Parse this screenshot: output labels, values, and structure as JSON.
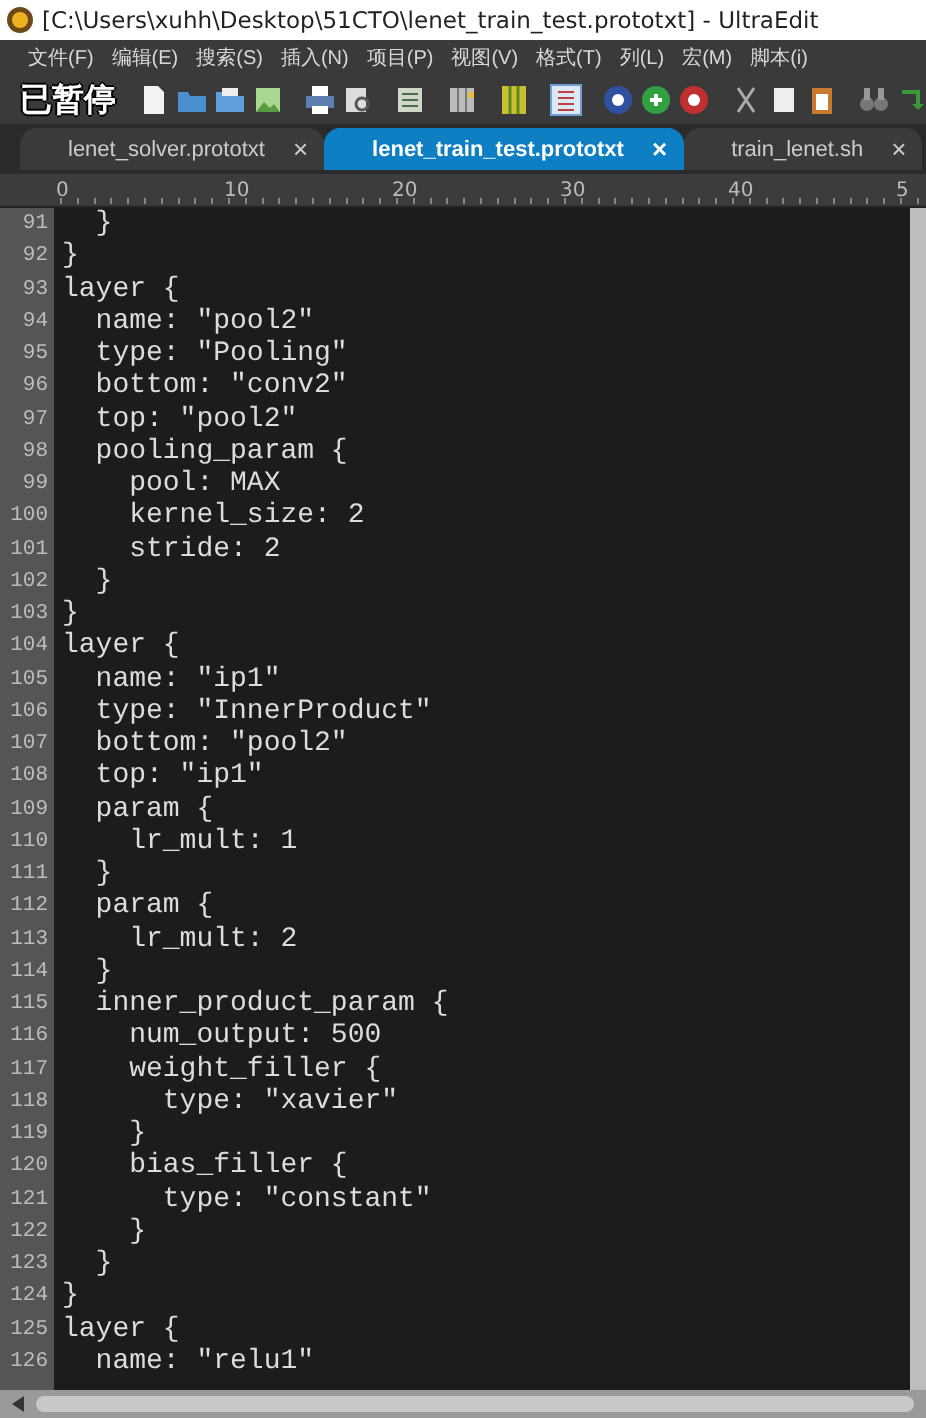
{
  "window": {
    "title": "[C:\\Users\\xuhh\\Desktop\\51CTO\\lenet_train_test.prototxt] - UltraEdit"
  },
  "menu": [
    "文件(F)",
    "编辑(E)",
    "搜索(S)",
    "插入(N)",
    "项目(P)",
    "视图(V)",
    "格式(T)",
    "列(L)",
    "宏(M)",
    "脚本(i)"
  ],
  "overlay": {
    "text": "已暂停"
  },
  "tabs": [
    {
      "label": "lenet_solver.prototxt",
      "close": "×",
      "selected": false
    },
    {
      "label": "lenet_train_test.prototxt",
      "close": "×",
      "selected": true
    },
    {
      "label": "train_lenet.sh",
      "close": "×",
      "selected": false
    }
  ],
  "ruler": [
    "0",
    "10",
    "20",
    "30",
    "40",
    "5"
  ],
  "lines": [
    {
      "number": "91",
      "text": "  }"
    },
    {
      "number": "92",
      "text": "}"
    },
    {
      "number": "93",
      "text": "layer {"
    },
    {
      "number": "94",
      "text": "  name: \"pool2\""
    },
    {
      "number": "95",
      "text": "  type: \"Pooling\""
    },
    {
      "number": "96",
      "text": "  bottom: \"conv2\""
    },
    {
      "number": "97",
      "text": "  top: \"pool2\""
    },
    {
      "number": "98",
      "text": "  pooling_param {"
    },
    {
      "number": "99",
      "text": "    pool: MAX"
    },
    {
      "number": "100",
      "text": "    kernel_size: 2"
    },
    {
      "number": "101",
      "text": "    stride: 2"
    },
    {
      "number": "102",
      "text": "  }"
    },
    {
      "number": "103",
      "text": "}"
    },
    {
      "number": "104",
      "text": "layer {"
    },
    {
      "number": "105",
      "text": "  name: \"ip1\""
    },
    {
      "number": "106",
      "text": "  type: \"InnerProduct\""
    },
    {
      "number": "107",
      "text": "  bottom: \"pool2\""
    },
    {
      "number": "108",
      "text": "  top: \"ip1\""
    },
    {
      "number": "109",
      "text": "  param {"
    },
    {
      "number": "110",
      "text": "    lr_mult: 1"
    },
    {
      "number": "111",
      "text": "  }"
    },
    {
      "number": "112",
      "text": "  param {"
    },
    {
      "number": "113",
      "text": "    lr_mult: 2"
    },
    {
      "number": "114",
      "text": "  }"
    },
    {
      "number": "115",
      "text": "  inner_product_param {"
    },
    {
      "number": "116",
      "text": "    num_output: 500"
    },
    {
      "number": "117",
      "text": "    weight_filler {"
    },
    {
      "number": "118",
      "text": "      type: \"xavier\""
    },
    {
      "number": "119",
      "text": "    }"
    },
    {
      "number": "120",
      "text": "    bias_filler {"
    },
    {
      "number": "121",
      "text": "      type: \"constant\""
    },
    {
      "number": "122",
      "text": "    }"
    },
    {
      "number": "123",
      "text": "  }"
    },
    {
      "number": "124",
      "text": "}"
    },
    {
      "number": "125",
      "text": "layer {"
    },
    {
      "number": "126",
      "text": "  name: \"relu1\""
    }
  ]
}
